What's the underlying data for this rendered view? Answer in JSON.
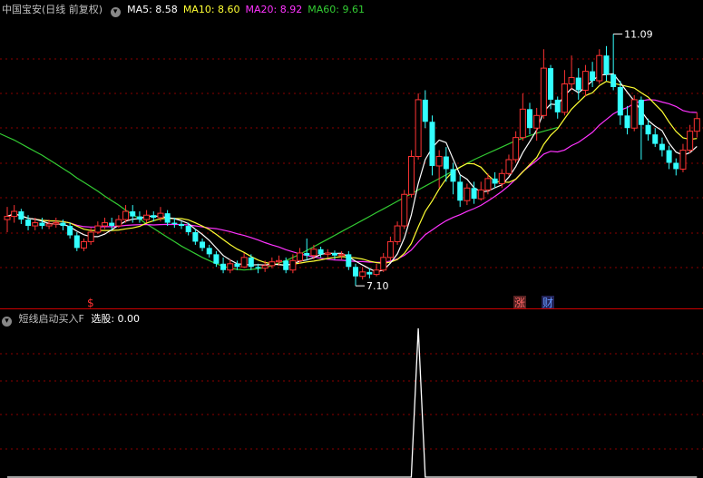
{
  "header": {
    "title": "中国宝安(日线 前复权)",
    "ma_items": [
      {
        "label": "MA5: 8.58",
        "color": "#ffffff"
      },
      {
        "label": "MA10: 8.60",
        "color": "#ffff33"
      },
      {
        "label": "MA20: 8.92",
        "color": "#ff33ff"
      },
      {
        "label": "MA60: 9.61",
        "color": "#33cc33"
      }
    ]
  },
  "indicator": {
    "title": "短线启动买入F",
    "value_label": "选股: 0.00"
  },
  "annotations": {
    "high": "11.09",
    "low": "7.10",
    "marker_dollar": "$",
    "marker_zhang": "涨",
    "marker_cai": "财"
  },
  "colors": {
    "background": "#000000",
    "up": "#ff3333",
    "down": "#33ffff",
    "grid": "#8b0000",
    "divider": "#cc0000",
    "ma5": "#ffffff",
    "ma10": "#ffff33",
    "ma20": "#ff33ff",
    "ma60": "#33cc33"
  },
  "chart_data": {
    "type": "candlestick",
    "ylim": [
      6.8,
      11.4
    ],
    "candles": [
      [
        8.15,
        8.2,
        8.35,
        7.95
      ],
      [
        8.2,
        8.28,
        8.38,
        8.1
      ],
      [
        8.28,
        8.15,
        8.32,
        8.08
      ],
      [
        8.15,
        8.05,
        8.22,
        7.98
      ],
      [
        8.05,
        8.1,
        8.18,
        7.98
      ],
      [
        8.1,
        8.05,
        8.18,
        8.0
      ],
      [
        8.05,
        8.08,
        8.15,
        8.0
      ],
      [
        8.08,
        8.1,
        8.18,
        8.02
      ],
      [
        8.1,
        8.05,
        8.15,
        7.98
      ],
      [
        8.05,
        7.9,
        8.1,
        7.85
      ],
      [
        7.9,
        7.7,
        7.95,
        7.65
      ],
      [
        7.7,
        7.8,
        7.85,
        7.65
      ],
      [
        7.8,
        7.95,
        8.02,
        7.75
      ],
      [
        7.95,
        8.05,
        8.12,
        7.92
      ],
      [
        8.05,
        8.1,
        8.18,
        8.0
      ],
      [
        8.1,
        8.05,
        8.18,
        7.98
      ],
      [
        8.05,
        8.15,
        8.22,
        8.02
      ],
      [
        8.15,
        8.28,
        8.38,
        8.1
      ],
      [
        8.28,
        8.2,
        8.38,
        8.1
      ],
      [
        8.2,
        8.15,
        8.28,
        8.1
      ],
      [
        8.15,
        8.22,
        8.3,
        8.1
      ],
      [
        8.22,
        8.18,
        8.28,
        8.12
      ],
      [
        8.18,
        8.25,
        8.35,
        8.12
      ],
      [
        8.25,
        8.1,
        8.3,
        8.05
      ],
      [
        8.1,
        8.08,
        8.18,
        8.02
      ],
      [
        8.08,
        8.05,
        8.12,
        8.0
      ],
      [
        8.05,
        7.95,
        8.1,
        7.9
      ],
      [
        7.95,
        7.8,
        8.0,
        7.75
      ],
      [
        7.8,
        7.7,
        7.85,
        7.65
      ],
      [
        7.7,
        7.6,
        7.75,
        7.55
      ],
      [
        7.6,
        7.45,
        7.65,
        7.4
      ],
      [
        7.45,
        7.35,
        7.55,
        7.3
      ],
      [
        7.35,
        7.45,
        7.52,
        7.3
      ],
      [
        7.45,
        7.4,
        7.5,
        7.35
      ],
      [
        7.4,
        7.55,
        7.62,
        7.38
      ],
      [
        7.55,
        7.4,
        7.6,
        7.35
      ],
      [
        7.4,
        7.38,
        7.45,
        7.3
      ],
      [
        7.38,
        7.42,
        7.5,
        7.32
      ],
      [
        7.42,
        7.48,
        7.55,
        7.38
      ],
      [
        7.48,
        7.5,
        7.58,
        7.42
      ],
      [
        7.5,
        7.35,
        7.55,
        7.3
      ],
      [
        7.35,
        7.5,
        7.6,
        7.3
      ],
      [
        7.5,
        7.62,
        7.7,
        7.45
      ],
      [
        7.62,
        7.58,
        7.85,
        7.5
      ],
      [
        7.58,
        7.68,
        7.75,
        7.52
      ],
      [
        7.68,
        7.6,
        7.72,
        7.55
      ],
      [
        7.6,
        7.62,
        7.68,
        7.55
      ],
      [
        7.62,
        7.58,
        7.66,
        7.52
      ],
      [
        7.58,
        7.6,
        7.65,
        7.52
      ],
      [
        7.6,
        7.4,
        7.65,
        7.35
      ],
      [
        7.4,
        7.25,
        7.45,
        7.1
      ],
      [
        7.25,
        7.32,
        7.4,
        7.2
      ],
      [
        7.32,
        7.28,
        7.38,
        7.22
      ],
      [
        7.28,
        7.35,
        7.45,
        7.25
      ],
      [
        7.35,
        7.55,
        7.62,
        7.32
      ],
      [
        7.55,
        7.8,
        7.88,
        7.5
      ],
      [
        7.8,
        8.05,
        8.12,
        7.75
      ],
      [
        8.05,
        8.55,
        8.62,
        8.0
      ],
      [
        8.55,
        9.15,
        9.25,
        8.5
      ],
      [
        9.15,
        10.05,
        10.15,
        9.1
      ],
      [
        10.05,
        9.7,
        10.2,
        9.6
      ],
      [
        9.7,
        9.0,
        9.8,
        8.85
      ],
      [
        9.0,
        9.15,
        9.25,
        8.65
      ],
      [
        9.15,
        8.95,
        9.3,
        8.75
      ],
      [
        8.95,
        8.75,
        9.05,
        8.55
      ],
      [
        8.75,
        8.45,
        8.85,
        8.35
      ],
      [
        8.45,
        8.65,
        8.72,
        8.38
      ],
      [
        8.65,
        8.48,
        8.75,
        8.4
      ],
      [
        8.48,
        8.62,
        8.75,
        8.45
      ],
      [
        8.62,
        8.8,
        8.88,
        8.55
      ],
      [
        8.8,
        8.72,
        8.9,
        8.65
      ],
      [
        8.72,
        8.88,
        8.95,
        8.65
      ],
      [
        8.88,
        9.1,
        9.18,
        8.85
      ],
      [
        9.1,
        9.45,
        9.55,
        9.05
      ],
      [
        9.45,
        9.9,
        10.15,
        9.4
      ],
      [
        9.9,
        9.6,
        10.0,
        9.5
      ],
      [
        9.6,
        9.8,
        9.92,
        9.4
      ],
      [
        9.8,
        10.55,
        10.85,
        9.75
      ],
      [
        10.55,
        10.05,
        10.6,
        9.9
      ],
      [
        10.05,
        9.85,
        10.1,
        9.75
      ],
      [
        9.85,
        10.3,
        10.52,
        9.8
      ],
      [
        10.3,
        10.4,
        10.75,
        10.2
      ],
      [
        10.4,
        10.2,
        10.55,
        10.05
      ],
      [
        10.2,
        10.5,
        10.6,
        10.1
      ],
      [
        10.5,
        10.35,
        10.65,
        10.25
      ],
      [
        10.35,
        10.75,
        10.85,
        10.3
      ],
      [
        10.75,
        10.45,
        10.9,
        10.35
      ],
      [
        10.45,
        10.25,
        11.09,
        10.2
      ],
      [
        10.25,
        9.8,
        10.35,
        9.65
      ],
      [
        9.8,
        9.6,
        9.95,
        9.5
      ],
      [
        9.6,
        10.05,
        10.12,
        9.55
      ],
      [
        10.05,
        9.65,
        10.1,
        9.1
      ],
      [
        9.65,
        9.5,
        9.75,
        9.4
      ],
      [
        9.5,
        9.35,
        9.6,
        9.3
      ],
      [
        9.35,
        9.25,
        9.45,
        9.15
      ],
      [
        9.25,
        9.05,
        9.32,
        8.95
      ],
      [
        9.05,
        8.95,
        9.12,
        8.85
      ],
      [
        8.95,
        9.25,
        9.35,
        8.9
      ],
      [
        9.25,
        9.55,
        9.65,
        9.2
      ],
      [
        9.55,
        9.75,
        9.85,
        9.45
      ]
    ],
    "ma60": [
      9.85,
      9.82,
      9.79,
      9.76,
      9.72,
      9.68,
      9.64,
      9.6,
      9.56,
      9.51,
      9.46,
      9.41,
      9.35,
      9.29,
      9.23,
      9.17,
      9.1,
      9.03,
      8.96,
      8.89,
      8.81,
      8.74,
      8.67,
      8.6,
      8.52,
      8.45,
      8.38,
      8.3,
      8.23,
      8.16,
      8.08,
      8.01,
      7.94,
      7.87,
      7.8,
      7.73,
      7.67,
      7.61,
      7.55,
      7.5,
      7.45,
      7.41,
      7.38,
      7.36,
      7.35,
      7.36,
      7.37,
      7.39,
      7.42,
      7.46,
      7.5,
      7.55,
      7.6,
      7.66,
      7.72,
      7.78,
      7.84,
      7.9,
      7.96,
      8.02,
      8.08,
      8.14,
      8.2,
      8.26,
      8.32,
      8.38,
      8.44,
      8.5,
      8.56,
      8.62,
      8.68,
      8.74,
      8.8,
      8.86,
      8.92,
      8.98,
      9.04,
      9.1,
      9.15,
      9.2,
      9.25,
      9.3,
      9.35,
      9.4,
      9.44,
      9.48,
      9.52,
      9.55,
      9.58,
      9.61
    ],
    "signal": [
      0,
      0,
      0,
      0,
      0,
      0,
      0,
      0,
      0,
      0,
      0,
      0,
      0,
      0,
      0,
      0,
      0,
      0,
      0,
      0,
      0,
      0,
      0,
      0,
      0,
      0,
      0,
      0,
      0,
      0,
      0,
      0,
      0,
      0,
      0,
      0,
      0,
      0,
      0,
      0,
      0,
      0,
      0,
      0,
      0,
      0,
      0,
      0,
      0,
      0,
      0,
      0,
      0,
      0,
      0,
      0,
      0,
      0,
      0,
      1,
      0,
      0,
      0,
      0,
      0,
      0,
      0,
      0,
      0,
      0,
      0,
      0,
      0,
      0,
      0,
      0,
      0,
      0,
      0,
      0,
      0,
      0,
      0,
      0,
      0,
      0,
      0,
      0,
      0,
      0,
      0,
      0,
      0,
      0,
      0,
      0,
      0,
      0,
      0,
      0
    ]
  }
}
